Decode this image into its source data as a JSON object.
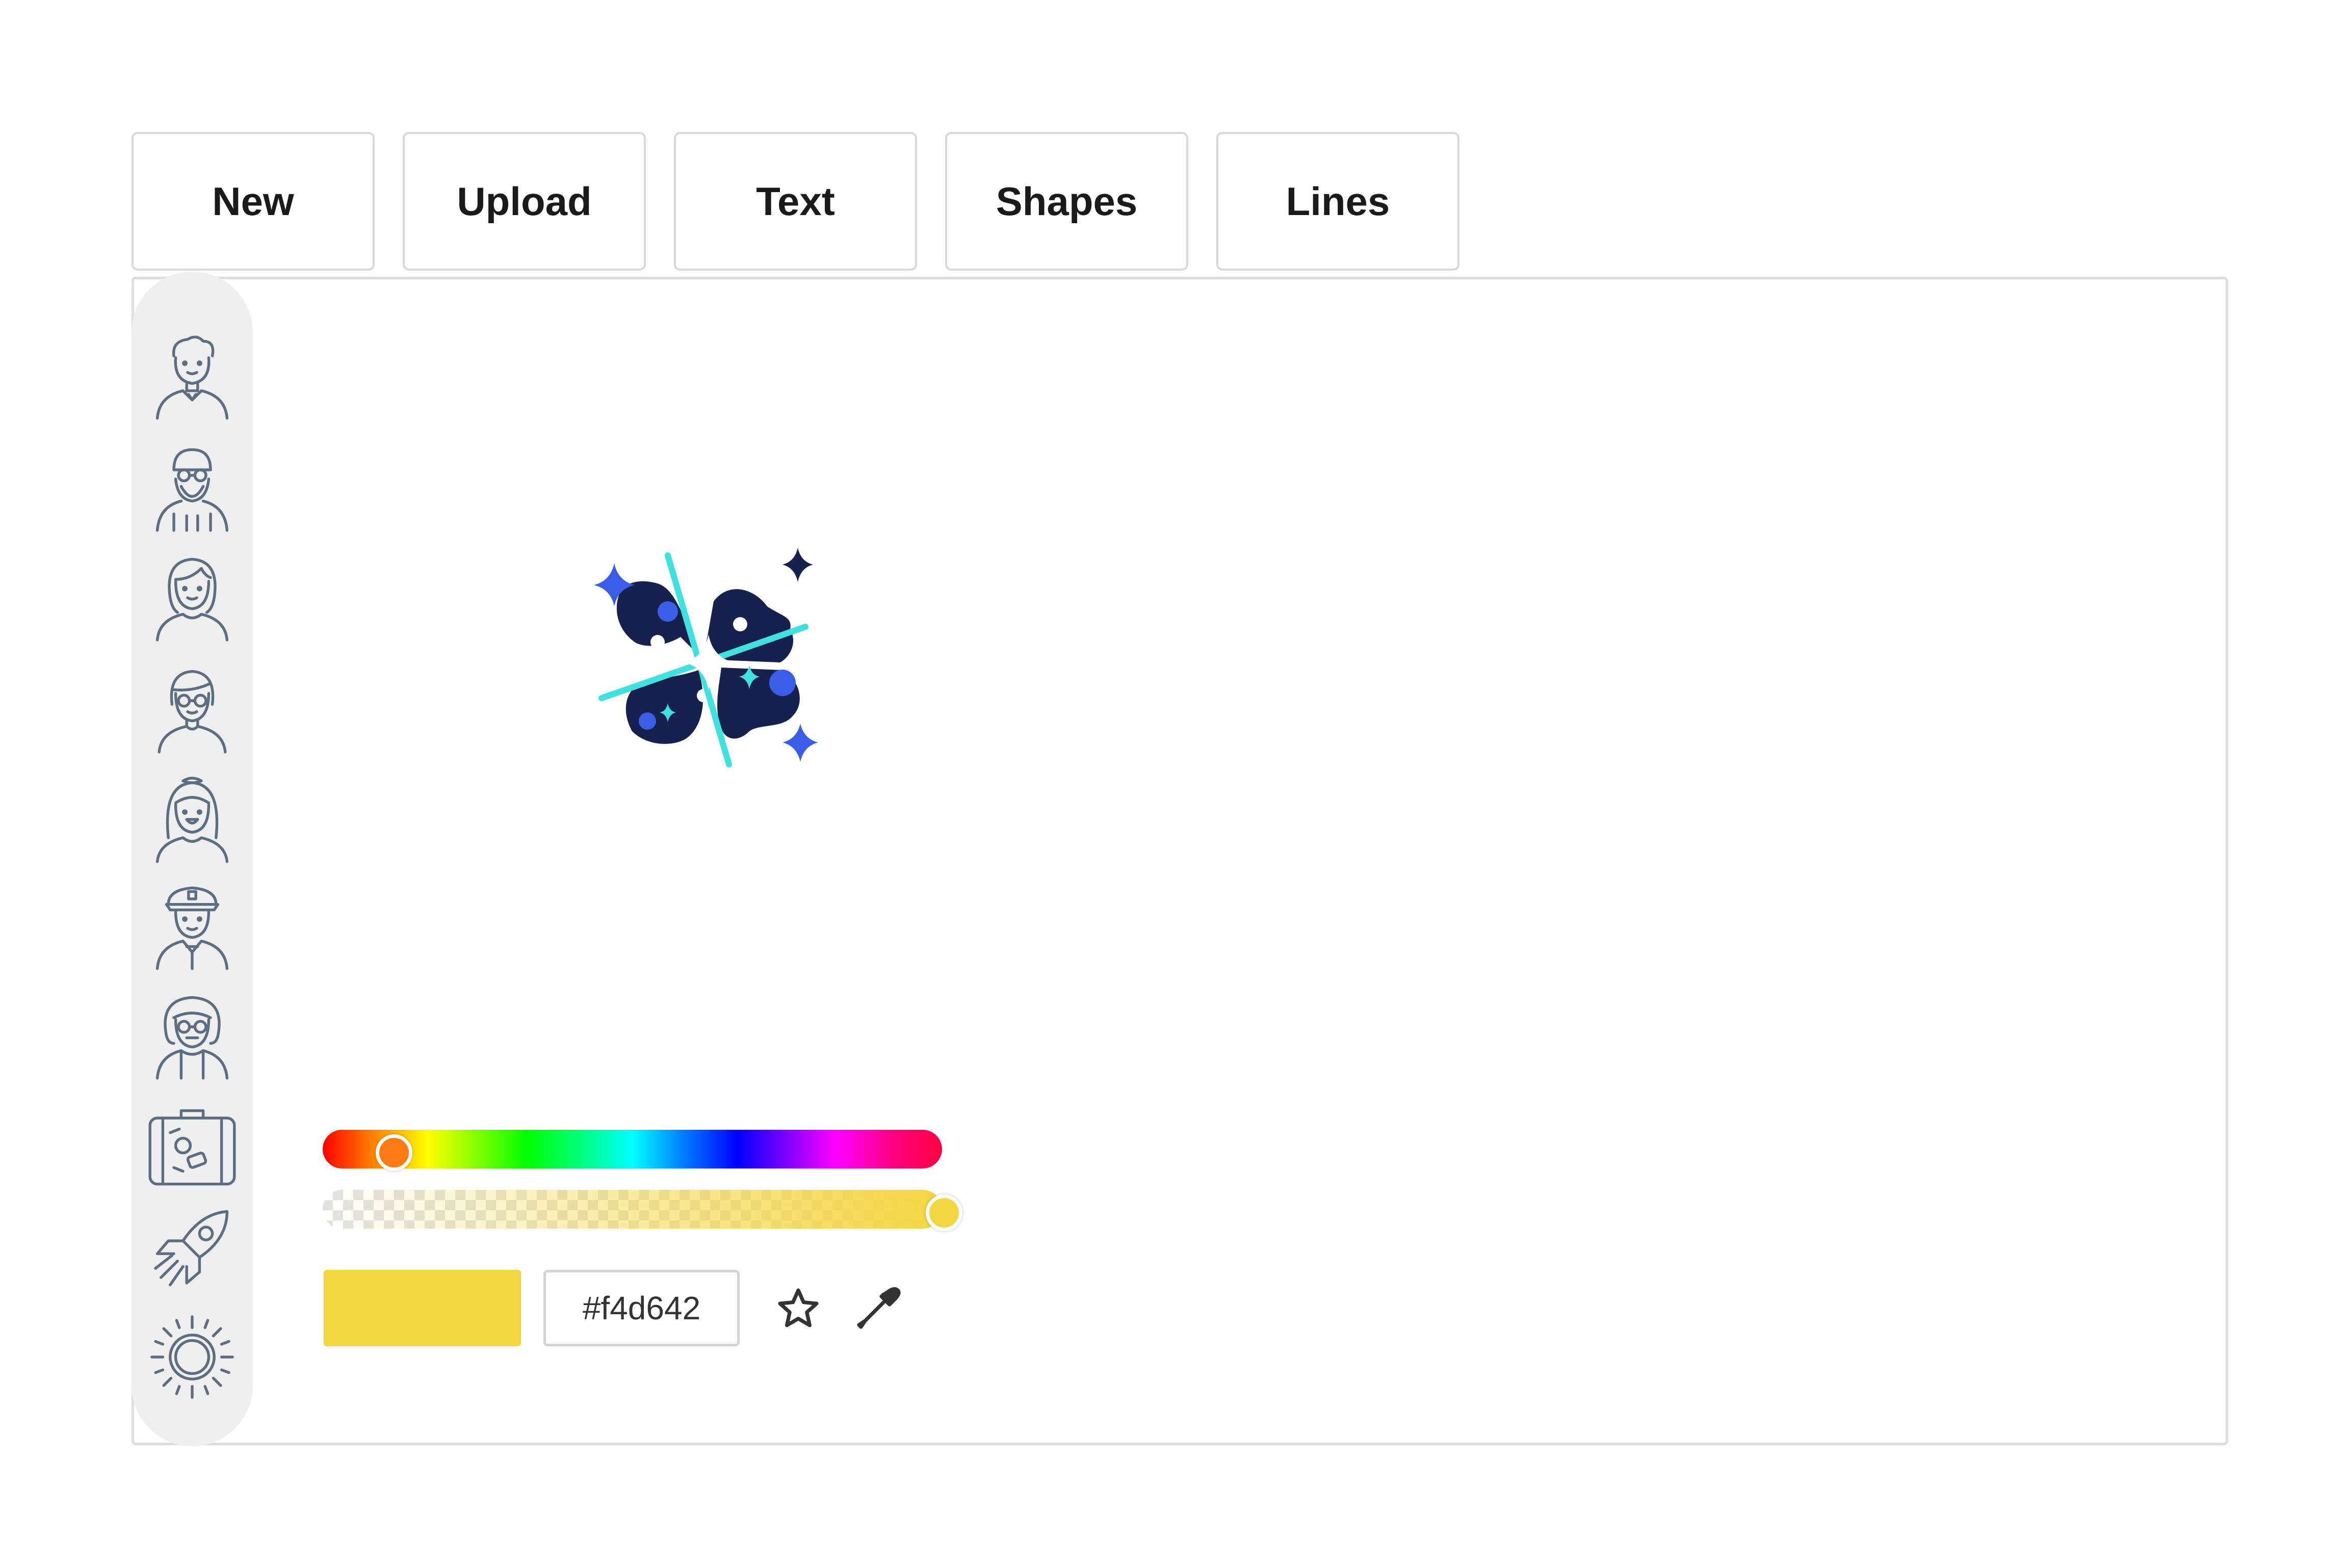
{
  "toolbar": {
    "buttons": [
      {
        "label": "New"
      },
      {
        "label": "Upload"
      },
      {
        "label": "Text"
      },
      {
        "label": "Shapes"
      },
      {
        "label": "Lines"
      }
    ]
  },
  "sidebar": {
    "items": [
      {
        "icon": "boy-avatar-icon"
      },
      {
        "icon": "bearded-man-avatar-icon"
      },
      {
        "icon": "woman-avatar-icon"
      },
      {
        "icon": "woman-with-glasses-avatar-icon"
      },
      {
        "icon": "girl-avatar-icon"
      },
      {
        "icon": "pilot-avatar-icon"
      },
      {
        "icon": "elderly-woman-avatar-icon"
      },
      {
        "icon": "suitcase-icon"
      },
      {
        "icon": "rocket-icon"
      },
      {
        "icon": "sun-icon"
      }
    ]
  },
  "canvas": {
    "sticker": "galaxy-sparkle-sticker"
  },
  "color_picker": {
    "hex_value": "#f4d642",
    "hue_position": 0.11,
    "alpha": 1.0,
    "selected_color": "#f4d642",
    "favorite_icon": "star-icon",
    "eyedropper_icon": "eyedropper-icon"
  },
  "colors": {
    "icon_stroke": "#5d6d82",
    "sidebar_bg": "#efefef",
    "sticker_dark": "#16224d",
    "sticker_accent": "#3a5ce6",
    "sticker_glow": "#3fe0e0"
  }
}
